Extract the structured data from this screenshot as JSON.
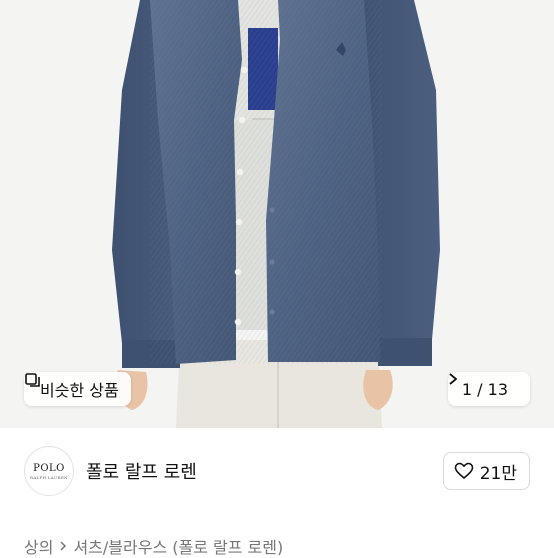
{
  "product_image": {
    "similar_button": {
      "icon": "similar-items-icon",
      "label": "비슷한 상품"
    },
    "page_indicator": {
      "label": "1 / 13",
      "icon": "chevron-right-icon"
    }
  },
  "store": {
    "logo": {
      "main": "POLO",
      "sub": "RALPH LAUREN"
    },
    "name": "폴로 랄프 로렌",
    "like": {
      "icon": "heart-outline-icon",
      "count": "21만"
    }
  },
  "breadcrumb": {
    "items": [
      "상의",
      "셔츠/블라우스 (폴로 랄프 로렌)"
    ],
    "separator_icon": "chevron-right-icon"
  }
}
